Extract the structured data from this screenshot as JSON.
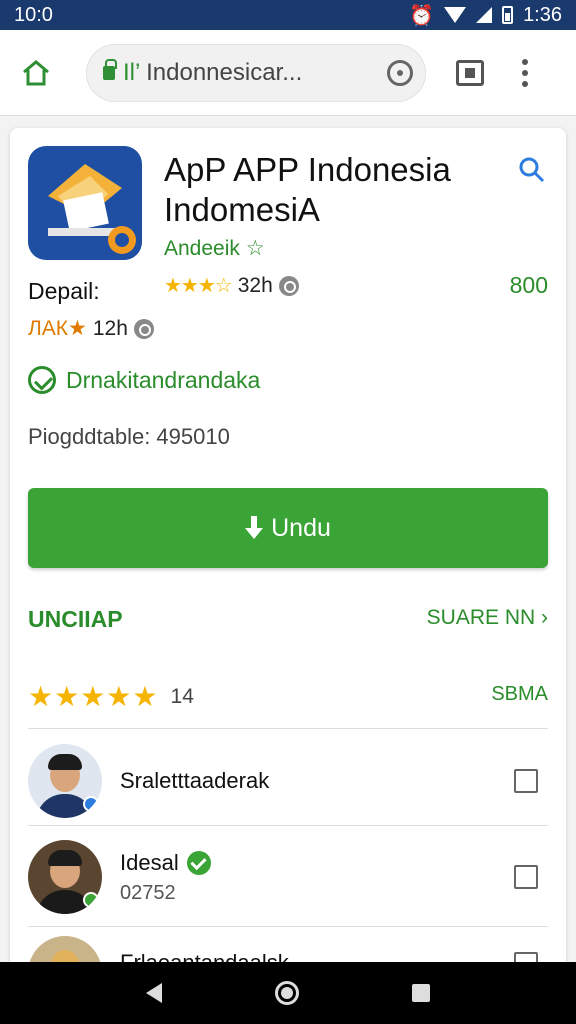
{
  "status_bar": {
    "time": "10:0",
    "clock": "1:36"
  },
  "browser": {
    "url_text": "Indonnesicar...",
    "url_prefix": "Il’"
  },
  "app": {
    "title": "ApP APP Indonesia IndomesiA",
    "developer": "Andeeik",
    "rating_stars": "★★★☆",
    "rating_time": "32h",
    "price": "800",
    "detail_label": "Depail:",
    "detail_orange": "ЛАК★",
    "detail_time": "12h",
    "verified_text": "Drnakitandrandaka",
    "downloads_text": "Piogddtable: 495010"
  },
  "actions": {
    "download_label": "Undu"
  },
  "section": {
    "heading": "UNCIIAP",
    "share_label": "SUARE NN ›",
    "rating_stars": "★★★★★",
    "rating_count": "14",
    "see_all_label": "SBMA"
  },
  "reviews": [
    {
      "name": "Sraletttaaderak",
      "sub": ""
    },
    {
      "name": "Idesal",
      "sub": "02752"
    },
    {
      "name": "Frlaeantandaalsk",
      "sub": ""
    }
  ],
  "colors": {
    "accent_green": "#3aa536",
    "status_bar": "#1a3a6e",
    "star": "#f5b400"
  }
}
